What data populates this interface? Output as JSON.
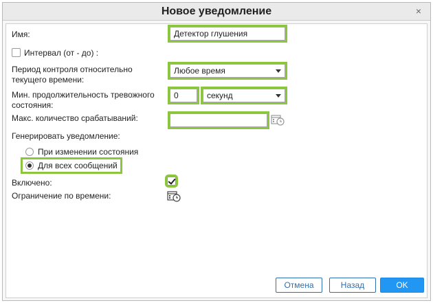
{
  "dialog": {
    "title": "Новое уведомление",
    "close_glyph": "×"
  },
  "form": {
    "name_label": "Имя:",
    "name_value": "Детектор глушения",
    "interval_label": "Интервал (от - до) :",
    "interval_checked": false,
    "period_label_line1": "Период контроля относительно",
    "period_label_line2": "текущего времени:",
    "period_value": "Любое время",
    "min_duration_label_line1": "Мин. продолжительность тревожного",
    "min_duration_label_line2": "состояния:",
    "min_duration_value": "0",
    "min_duration_unit": "секунд",
    "max_triggers_label": "Макс. количество срабатываний:",
    "max_triggers_value": "",
    "generate_label": "Генерировать уведомление:",
    "radio_on_change": "При изменении состояния",
    "radio_all_messages": "Для всех сообщений",
    "selected_radio": "all_messages",
    "enabled_label": "Включено:",
    "enabled_checked": true,
    "time_limit_label": "Ограничение по времени:"
  },
  "buttons": {
    "cancel": "Отмена",
    "back": "Назад",
    "ok": "OK"
  },
  "icons": {
    "schedule": "calendar-clock-icon"
  },
  "colors": {
    "highlight": "#8cc63f",
    "primary": "#2196f3",
    "link": "#2c6fb5"
  }
}
